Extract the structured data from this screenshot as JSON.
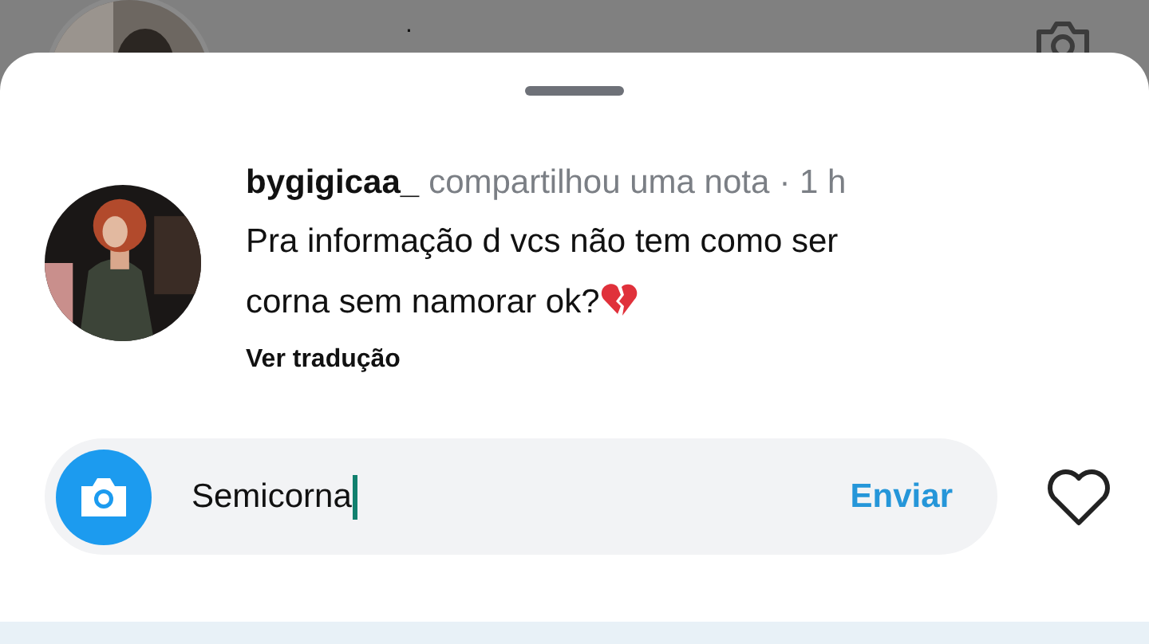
{
  "background": {
    "caption": "."
  },
  "note": {
    "username": "bygigicaa_",
    "action": "compartilhou uma nota",
    "time": "· 1 h",
    "text": "Pra informação d vcs não tem como ser corna sem namorar ok?",
    "translate_link": "Ver tradução"
  },
  "reply": {
    "value": "Semicorna",
    "send_label": "Enviar",
    "liked": false
  }
}
